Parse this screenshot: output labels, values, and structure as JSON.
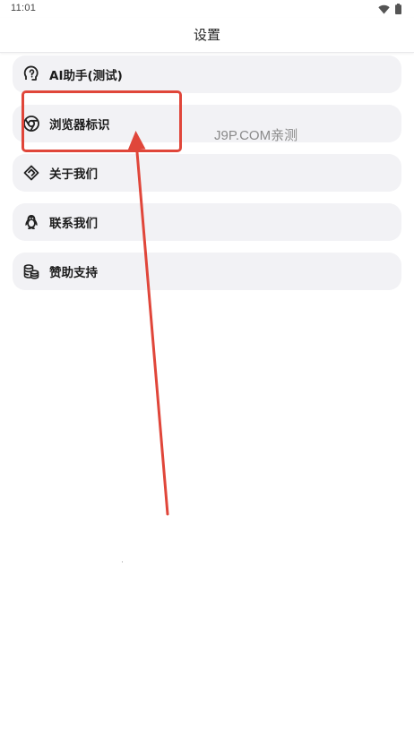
{
  "status_bar": {
    "time": "11:01",
    "icons": [
      "wifi-icon",
      "battery-icon"
    ]
  },
  "header": {
    "title": "设置"
  },
  "menu": {
    "items": [
      {
        "label": "AI助手(测试)",
        "icon": "ai-head-icon"
      },
      {
        "label": "浏览器标识",
        "icon": "chrome-icon"
      },
      {
        "label": "关于我们",
        "icon": "diamond-icon"
      },
      {
        "label": "联系我们",
        "icon": "qq-penguin-icon"
      },
      {
        "label": "赞助支持",
        "icon": "coins-icon"
      }
    ]
  },
  "annotation": {
    "watermark": "J9P.COM亲测",
    "highlight_color": "#e0463a",
    "arrow_color": "#e0463a"
  },
  "colors": {
    "item_background": "#f2f2f5",
    "text": "#1c1c1c"
  }
}
